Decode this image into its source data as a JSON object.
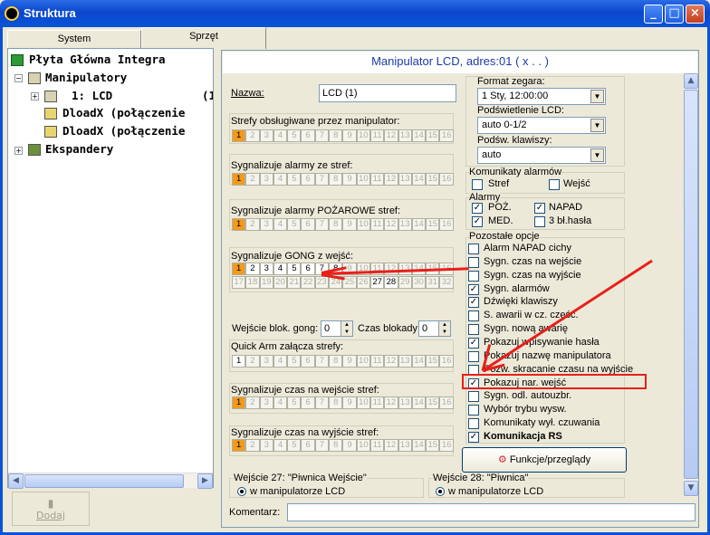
{
  "window": {
    "title": "Struktura"
  },
  "tabs": [
    "System",
    "Sprzęt"
  ],
  "tree": {
    "items": [
      "Płyta Główna Integra",
      "Manipulatory",
      "1: LCD",
      "(1",
      "DloadX (połączenie",
      "DloadX (połączenie",
      "Ekspandery"
    ]
  },
  "sidebar": {
    "add_button": "Dodaj"
  },
  "panel": {
    "header": "Manipulator LCD, adres:01 ( x . . )",
    "name_label": "Nazwa:",
    "name_value": "LCD          (1)",
    "clock_format_label": "Format zegara:",
    "clock_format_value": "1 Sty, 12:00:00",
    "lcd_backlight_label": "Podświetlenie  LCD:",
    "lcd_backlight_value": "auto 0-1/2",
    "key_backlight_label": "Podśw. klawiszy:",
    "key_backlight_value": "auto",
    "zones_label": "Strefy obsługiwane przez manipulator:",
    "alarm_zones_label": "Sygnalizuje alarmy ze stref:",
    "fire_zones_label": "Sygnalizuje alarmy POŻAROWE stref:",
    "gong_label": "Sygnalizuje GONG z wejść:",
    "gong_block_label": "Wejście blok. gong:",
    "gong_block_value": "0",
    "block_time_label": "Czas blokady:",
    "block_time_value": "0",
    "quick_arm_label": "Quick Arm załącza strefy:",
    "entry_time_label": "Sygnalizuje czas na wejście stref:",
    "exit_time_label": "Sygnalizuje czas na wyjście stref:",
    "alarm_msgs": {
      "title": "Komunikaty alarmów",
      "opt1": "Stref",
      "opt2": "Wejść"
    },
    "alarms": {
      "title": "Alarmy",
      "poz": "POŻ.",
      "napad": "NAPAD",
      "med": "MED.",
      "bad_pwd": "3 bł.hasła"
    },
    "other": {
      "title": "Pozostałe opcje",
      "options": [
        "Alarm NAPAD cichy",
        "Sygn. czas na wejście",
        "Sygn. czas na wyjście",
        "Sygn. alarmów",
        "Dźwięki klawiszy",
        "S. awarii w cz. częśc.",
        "Sygn. nową awarię",
        "Pokazuj wpisywanie hasła",
        "Pokazuj nazwę manipulatora",
        "Pozw. skracanie czasu na wyjście",
        "Pokazuj nar. wejść",
        "Sygn. odl. autouzbr.",
        "Wybór trybu wysw.",
        "Komunikaty wył. czuwania",
        "Komunikacja RS"
      ],
      "checked": [
        false,
        false,
        false,
        true,
        true,
        false,
        false,
        true,
        false,
        false,
        true,
        false,
        false,
        false,
        true
      ]
    },
    "functions_button": "Funkcje/przeglądy",
    "input27_title": "Wejście 27: \"Piwnica Wejście\"",
    "input27_value": "w manipulatorze LCD",
    "input28_title": "Wejście 28: \"Piwnica\"",
    "input28_value": "w manipulatorze LCD",
    "comment_label": "Komentarz:"
  },
  "gong_inputs": [
    "1",
    "2",
    "3",
    "4",
    "5",
    "6",
    "7",
    "8",
    "9",
    "10",
    "11",
    "12",
    "13",
    "14",
    "15",
    "16",
    "17",
    "18",
    "19",
    "20",
    "21",
    "22",
    "23",
    "24",
    "25",
    "26",
    "27",
    "28",
    "29",
    "30",
    "31",
    "32"
  ],
  "zones": [
    "1",
    "2",
    "3",
    "4",
    "5",
    "6",
    "7",
    "8",
    "9",
    "10",
    "11",
    "12",
    "13",
    "14",
    "15",
    "16"
  ],
  "colors": {
    "accent": "#f39a1b",
    "highlight": "#e8201b",
    "titlebar": "#0953d8"
  }
}
